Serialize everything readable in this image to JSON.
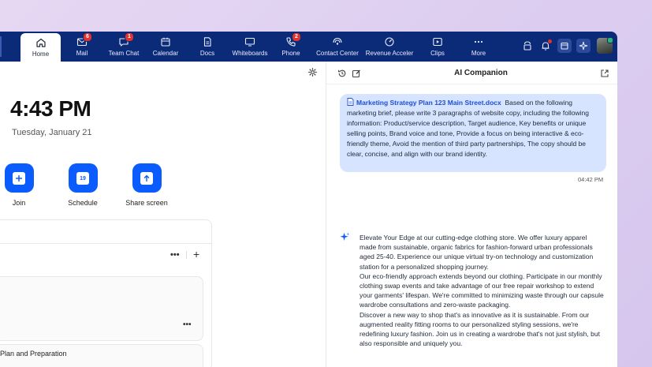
{
  "nav": {
    "items": [
      {
        "label": "Home",
        "icon": "home-icon",
        "active": true
      },
      {
        "label": "Mail",
        "icon": "mail-icon",
        "badge": "6"
      },
      {
        "label": "Team Chat",
        "icon": "chat-icon",
        "badge": "1"
      },
      {
        "label": "Calendar",
        "icon": "calendar-icon"
      },
      {
        "label": "Docs",
        "icon": "docs-icon"
      },
      {
        "label": "Whiteboards",
        "icon": "whiteboard-icon"
      },
      {
        "label": "Phone",
        "icon": "phone-icon",
        "badge": "2"
      },
      {
        "label": "Contact Center",
        "icon": "contact-center-icon"
      },
      {
        "label": "Revenue Acceler",
        "icon": "revenue-icon"
      },
      {
        "label": "Clips",
        "icon": "clips-icon"
      },
      {
        "label": "More",
        "icon": "more-icon"
      }
    ]
  },
  "home": {
    "time": "4:43 PM",
    "date": "Tuesday, January 21",
    "actions": [
      {
        "label": "Join",
        "icon": "plus-icon"
      },
      {
        "label": "Schedule",
        "icon": "calendar-icon",
        "day": "19"
      },
      {
        "label": "Share screen",
        "icon": "share-arrow-icon"
      }
    ],
    "more_dots": "•••",
    "add": "+",
    "card_dots": "•••",
    "card2_title": "Plan and Preparation"
  },
  "ai": {
    "title": "AI Companion",
    "user_message": {
      "attachment": "Marketing Strategy Plan 123 Main Street.docx",
      "text": "Based on the following marketing brief, please write 3 paragraphs of website copy, including the following information: Product/service description, Target audience, Key benefits or unique selling points, Brand voice and tone, Provide a focus on being interactive & eco-friendly theme, Avoid the mention of third party partnerships, The copy should be clear, concise, and align with our brand identity.",
      "time": "04:42 PM"
    },
    "reply": [
      "Elevate Your Edge at our cutting-edge clothing store. We offer luxury apparel made from sustainable, organic fabrics for fashion-forward urban professionals aged 25-40. Experience our unique virtual try-on technology and customization station for a personalized shopping journey.",
      "Our eco-friendly approach extends beyond our clothing. Participate in our monthly clothing swap events and take advantage of our free repair workshop to extend your garments' lifespan. We're committed to minimizing waste through our capsule wardrobe consultations and zero-waste packaging.",
      "Discover a new way to shop that's as innovative as it is sustainable. From our augmented reality fitting rooms to our personalized styling sessions, we're redefining luxury fashion. Join us in creating a wardrobe that's not just stylish, but also responsible and uniquely you."
    ]
  },
  "colors": {
    "nav_bg": "#0b2a78",
    "accent": "#0b5cff",
    "bubble": "#d6e4ff",
    "badge": "#e0322f"
  }
}
